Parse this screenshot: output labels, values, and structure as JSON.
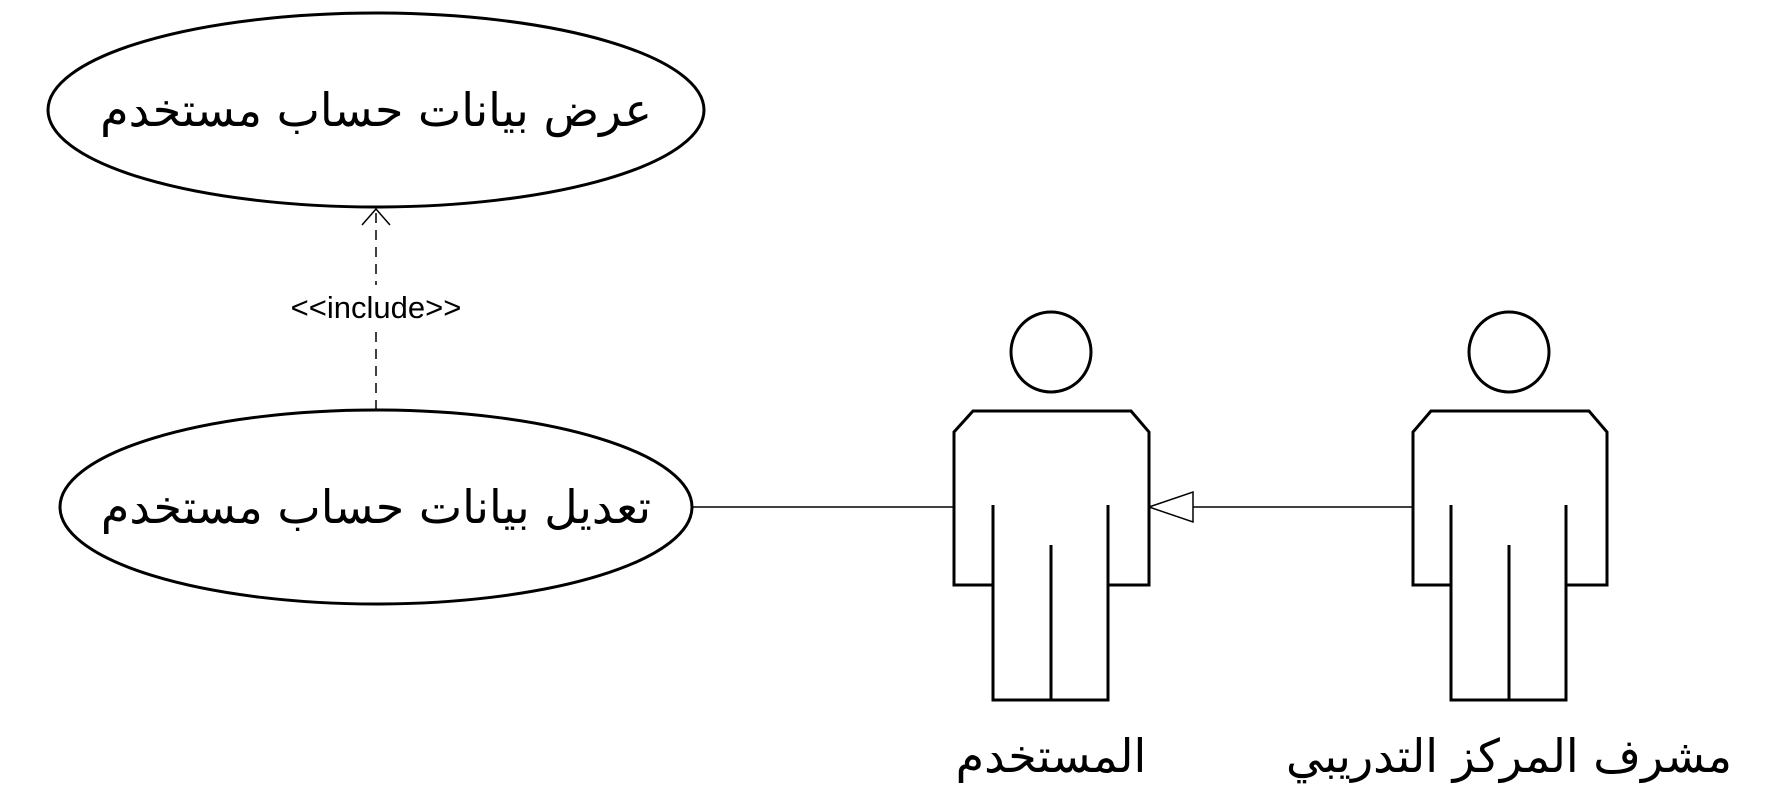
{
  "diagram": {
    "use_cases": [
      {
        "id": "view-account",
        "label": "عرض بيانات حساب مستخدم"
      },
      {
        "id": "edit-account",
        "label": "تعديل بيانات حساب مستخدم"
      }
    ],
    "actors": [
      {
        "id": "user",
        "label": "المستخدم"
      },
      {
        "id": "training-supervisor",
        "label": "مشرف المركز التدريبي"
      }
    ],
    "relations": [
      {
        "type": "include",
        "from": "edit-account",
        "to": "view-account",
        "label": "<<include>>"
      },
      {
        "type": "association",
        "from": "user",
        "to": "edit-account"
      },
      {
        "type": "generalization",
        "from": "training-supervisor",
        "to": "user"
      }
    ],
    "colors": {
      "stroke": "#000000",
      "background": "#ffffff"
    }
  }
}
